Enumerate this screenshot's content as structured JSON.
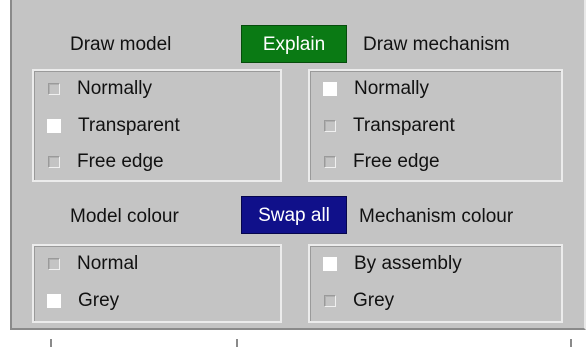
{
  "draw_model": {
    "heading": "Draw model",
    "options": [
      {
        "label": "Normally",
        "checked": false
      },
      {
        "label": "Transparent",
        "checked": true
      },
      {
        "label": "Free edge",
        "checked": false
      }
    ]
  },
  "explain_button": {
    "label": "Explain",
    "color": "#0a7a14"
  },
  "draw_mechanism": {
    "heading": "Draw mechanism",
    "options": [
      {
        "label": "Normally",
        "checked": true
      },
      {
        "label": "Transparent",
        "checked": false
      },
      {
        "label": "Free edge",
        "checked": false
      }
    ]
  },
  "model_colour": {
    "heading": "Model colour",
    "options": [
      {
        "label": "Normal",
        "checked": false
      },
      {
        "label": "Grey",
        "checked": true
      }
    ]
  },
  "swap_all_button": {
    "label": "Swap all",
    "color": "#10108a"
  },
  "mechanism_colour": {
    "heading": "Mechanism colour",
    "options": [
      {
        "label": "By assembly",
        "checked": true
      },
      {
        "label": "Grey",
        "checked": false
      }
    ]
  }
}
